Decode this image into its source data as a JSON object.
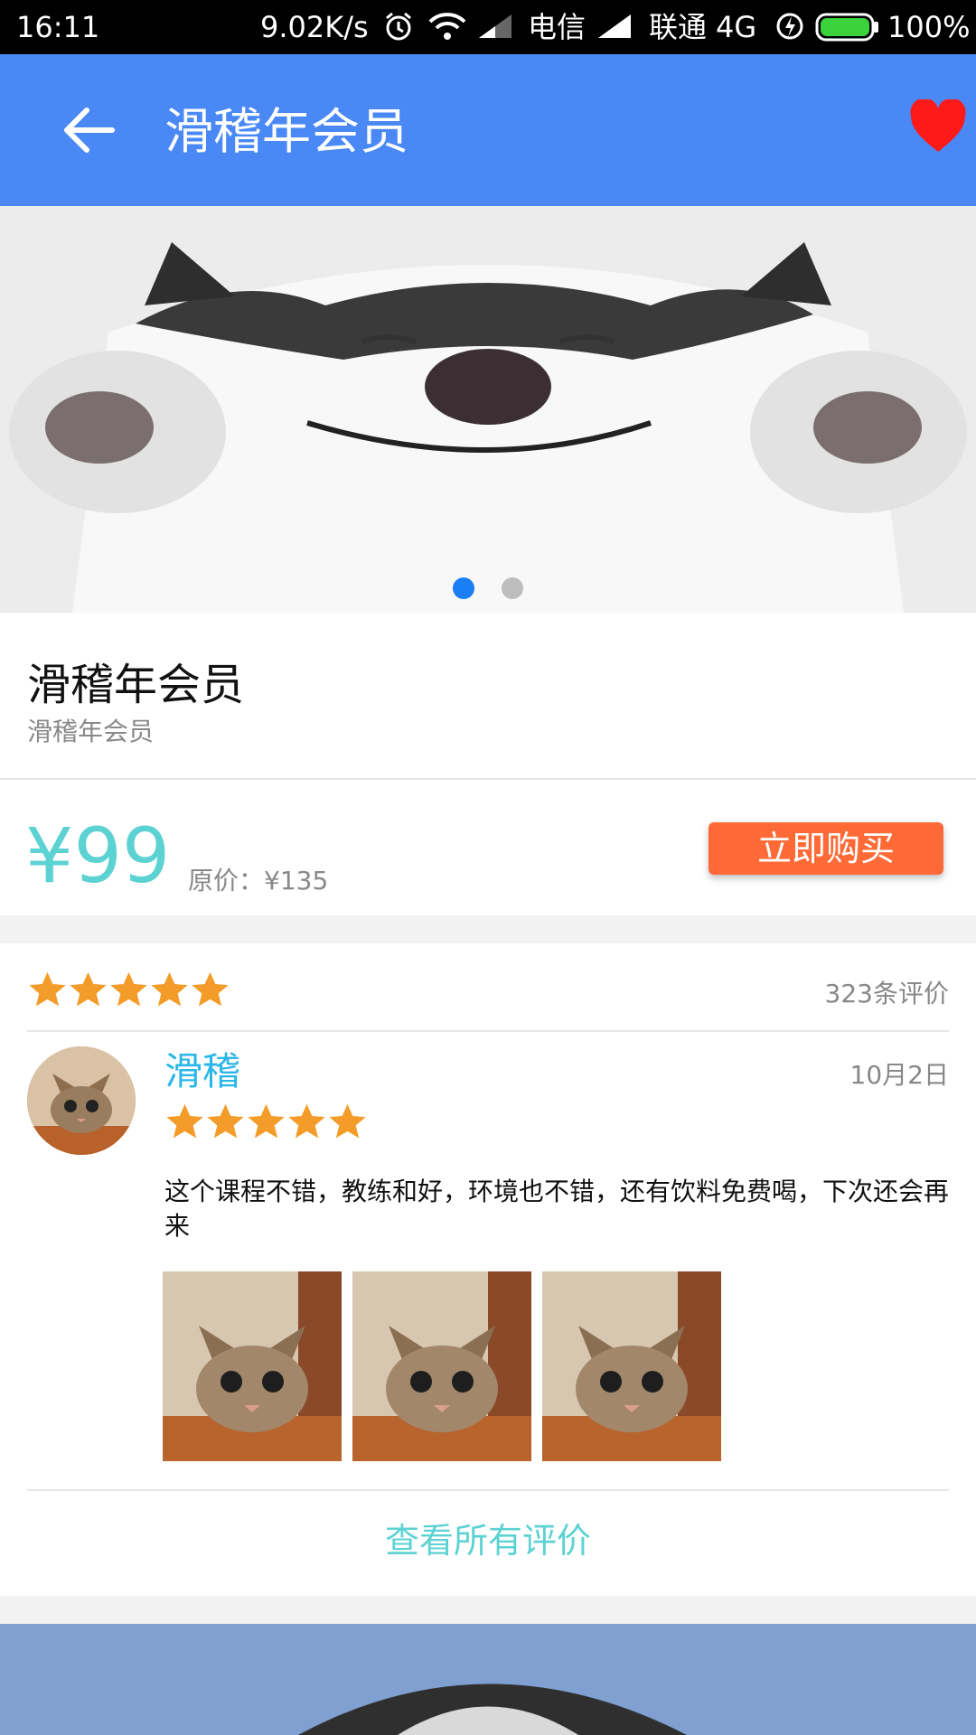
{
  "status_bar": {
    "time": "16:11",
    "speed": "9.02K/s",
    "carrier1": "电信",
    "carrier2": "联通",
    "network": "4G",
    "battery": "100%",
    "icons": [
      "alarm-icon",
      "wifi-icon",
      "signal-icon",
      "charging-icon",
      "battery-icon"
    ]
  },
  "app_bar": {
    "title": "滑稽年会员",
    "back_icon": "arrow-left-icon",
    "favorite_icon": "heart-icon",
    "favorite_color": "#ff1a1a",
    "color": "#4a89f5"
  },
  "banner": {
    "image": "husky-dog-photo",
    "slides": 2,
    "active_slide": 1,
    "dot_active_color": "#1a7ef5",
    "dot_inactive_color": "#bdbdbd"
  },
  "product": {
    "title": "滑稽年会员",
    "subtitle": "滑稽年会员"
  },
  "price": {
    "current": "¥99",
    "original": "原价：¥135",
    "buy_label": "立即购买",
    "price_color": "#5dd2d2",
    "buy_color": "#ff6a36"
  },
  "reviews": {
    "rating": 5,
    "count_label": "323条评价",
    "star_color": "#f39c29",
    "items": [
      {
        "username": "滑稽",
        "date": "10月2日",
        "rating": 5,
        "text": "这个课程不错，教练和好，环境也不错，还有饮料免费喝，下次还会再来",
        "avatar": "cat-avatar",
        "photos": [
          "cat-photo",
          "cat-photo",
          "cat-photo"
        ]
      }
    ],
    "view_all_label": "查看所有评价"
  },
  "bottom_banner": {
    "image": "husky-puppy-photo"
  }
}
